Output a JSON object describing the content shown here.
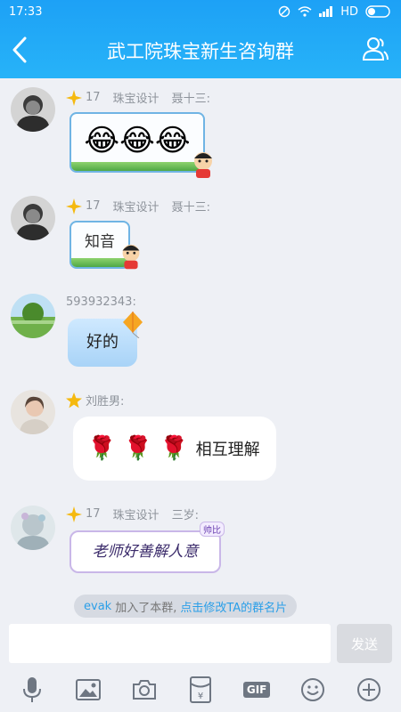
{
  "status": {
    "time": "17:33",
    "network": "HD"
  },
  "header": {
    "title": "武工院珠宝新生咨询群"
  },
  "messages": [
    {
      "level": "17",
      "tag": "珠宝设计",
      "name": "聂十三:",
      "content": "😂😂😂"
    },
    {
      "level": "17",
      "tag": "珠宝设计",
      "name": "聂十三:",
      "content": "知音"
    },
    {
      "name": "593932343:",
      "content": "好的"
    },
    {
      "name": "刘胜男:",
      "content": "🌹 🌹 🌹",
      "suffix": "相互理解"
    },
    {
      "level": "17",
      "tag": "珠宝设计",
      "name": "三岁:",
      "content": "老师好善解人意",
      "sticker_badge": "帅比"
    }
  ],
  "system_note": {
    "user": "evak",
    "action": "加入了本群,",
    "link": "点击修改TA的群名片"
  },
  "input": {
    "value": "",
    "send_label": "发送"
  },
  "toolbar": {
    "gif_label": "GIF"
  },
  "colors": {
    "header": "#1da1f6",
    "link": "#2b9fe8",
    "background": "#eef0f5"
  }
}
